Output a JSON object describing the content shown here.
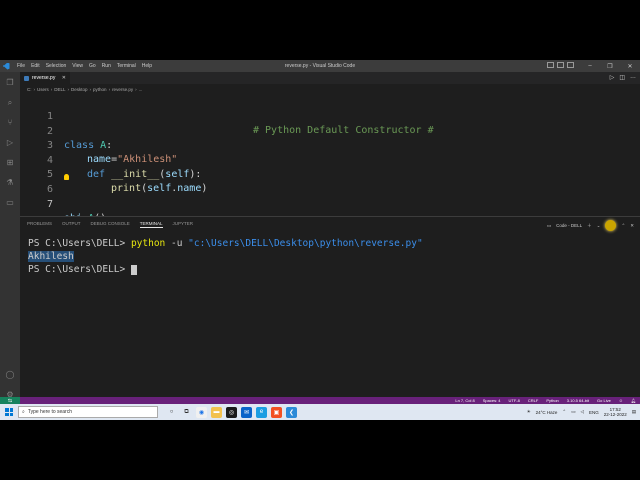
{
  "titlebar": {
    "menu": [
      "File",
      "Edit",
      "Selection",
      "View",
      "Go",
      "Run",
      "Terminal",
      "Help"
    ],
    "window_title": "reverse.py - Visual Studio Code"
  },
  "tab": {
    "label": "reverse.py"
  },
  "breadcrumb": [
    "C:",
    "Users",
    "DELL",
    "Desktop",
    "python",
    "reverse.py",
    "..."
  ],
  "editor": {
    "line_numbers": [
      "1",
      "2",
      "3",
      "4",
      "5",
      "6",
      "7"
    ],
    "comment": "# Python Default Constructor #",
    "l2_kw": "class",
    "l2_cls": "A",
    "l2_colon": ":",
    "l3_var": "name",
    "l3_eq": "=",
    "l3_str": "\"Akhilesh\"",
    "l4_kw": "def",
    "l4_fn": "__init__",
    "l4_open": "(",
    "l4_self": "self",
    "l4_close": "):",
    "l5_fn": "print",
    "l5_open": "(",
    "l5_self": "self",
    "l5_dot": ".",
    "l5_attr": "name",
    "l5_close": ")",
    "l7_var": "obj",
    "l7_eq": "=",
    "l7_cls": "A",
    "l7_paren": "()"
  },
  "panel": {
    "tabs": [
      "PROBLEMS",
      "OUTPUT",
      "DEBUG CONSOLE",
      "TERMINAL",
      "JUPYTER"
    ],
    "terminal_name": "Code - DELL",
    "terminal": {
      "prompt1": "PS C:\\Users\\DELL> ",
      "cmd": "python",
      "flag": " -u ",
      "path": "\"c:\\Users\\DELL\\Desktop\\python\\reverse.py\"",
      "output": "Akhilesh",
      "prompt2": "PS C:\\Users\\DELL> "
    }
  },
  "statusbar": {
    "position": "Ln 7, Col 8",
    "spaces": "Spaces: 4",
    "encoding": "UTF-8",
    "eol": "CRLF",
    "language": "Python",
    "interpreter": "3.10.5 64-bit",
    "golive": "Go Live"
  },
  "taskbar": {
    "search_placeholder": "Type here to search",
    "weather": "24°C  Haze",
    "lang": "ENG",
    "time": "17:52",
    "date": "22-12-2022"
  }
}
